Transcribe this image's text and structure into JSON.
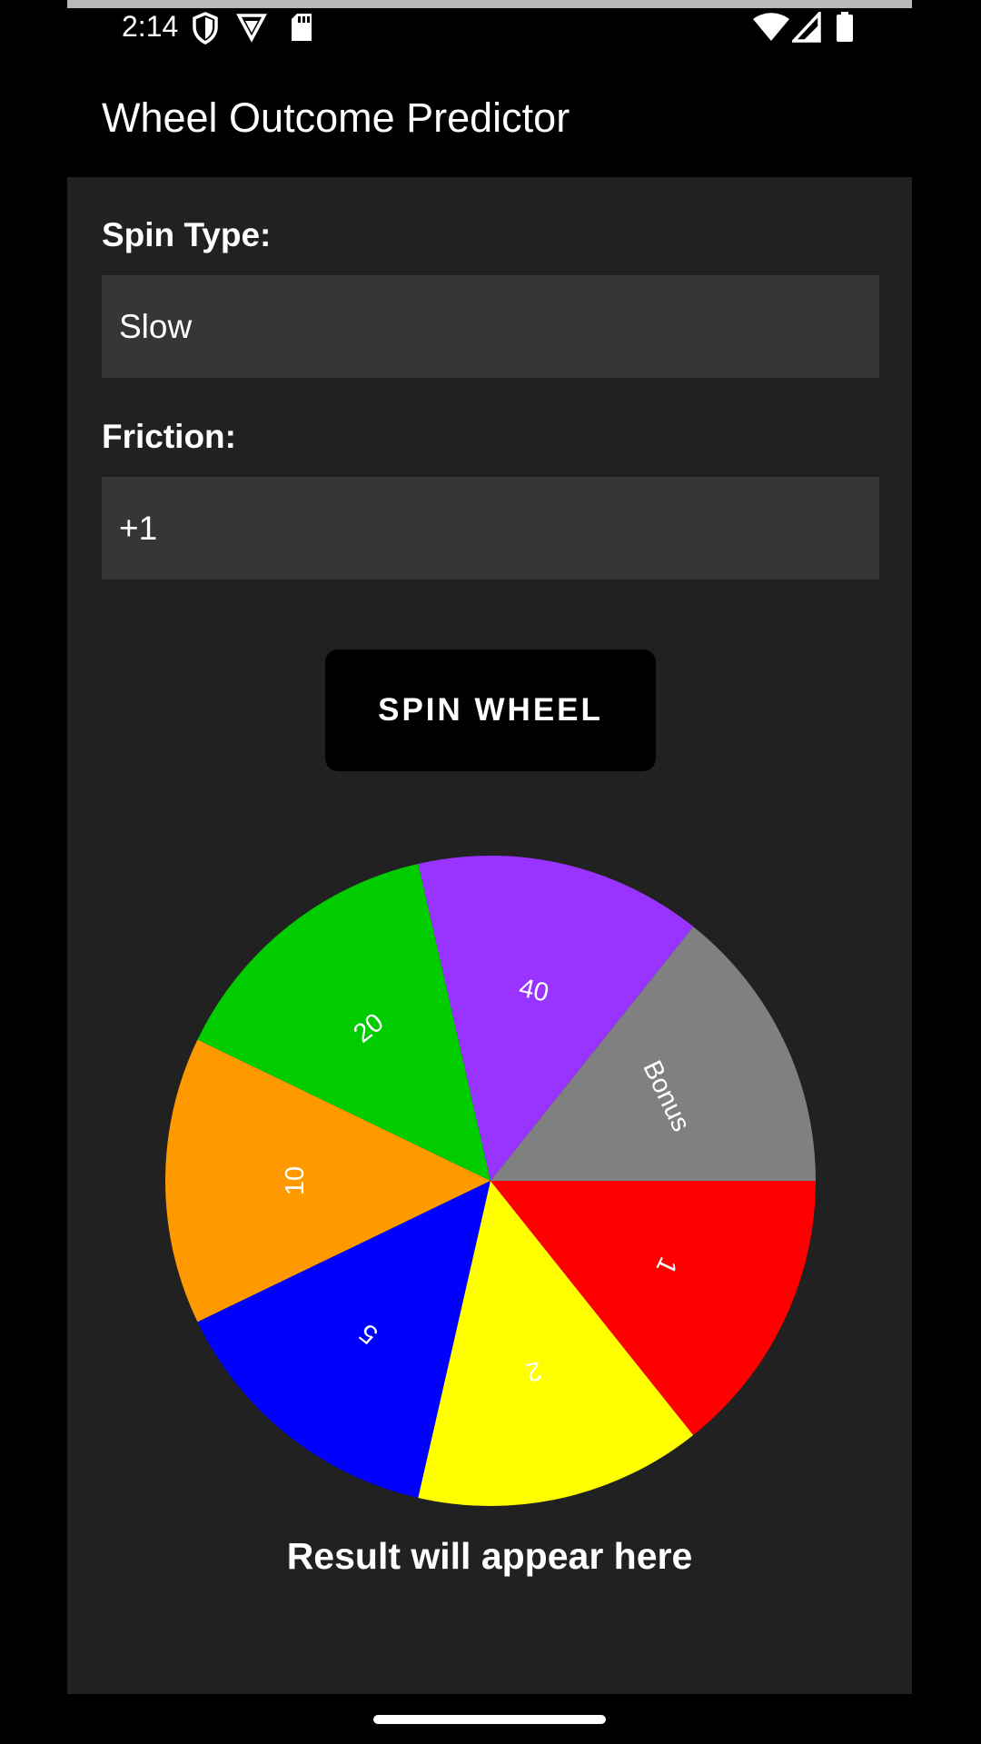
{
  "status": {
    "time": "2:14"
  },
  "app": {
    "title": "Wheel Outcome Predictor"
  },
  "form": {
    "spin_type_label": "Spin Type:",
    "spin_type_value": "Slow",
    "friction_label": "Friction:",
    "friction_value": "+1",
    "spin_button_label": "SPIN WHEEL"
  },
  "wheel": {
    "segments": [
      {
        "label": "Bonus",
        "color": "#808080"
      },
      {
        "label": "40",
        "color": "#9933FF"
      },
      {
        "label": "20",
        "color": "#00CC00"
      },
      {
        "label": "10",
        "color": "#FF9900"
      },
      {
        "label": "5",
        "color": "#0000FF"
      },
      {
        "label": "2",
        "color": "#FFFF00"
      },
      {
        "label": "1",
        "color": "#FF0000"
      }
    ]
  },
  "result": {
    "text": "Result will appear here"
  },
  "colors": {
    "background": "#212121",
    "field": "#363636",
    "bar": "#000000",
    "text": "#FFFFFF"
  },
  "icons": [
    "shield-icon",
    "vpn-icon",
    "sd-card-icon",
    "wifi-icon",
    "signal-icon",
    "battery-icon"
  ]
}
